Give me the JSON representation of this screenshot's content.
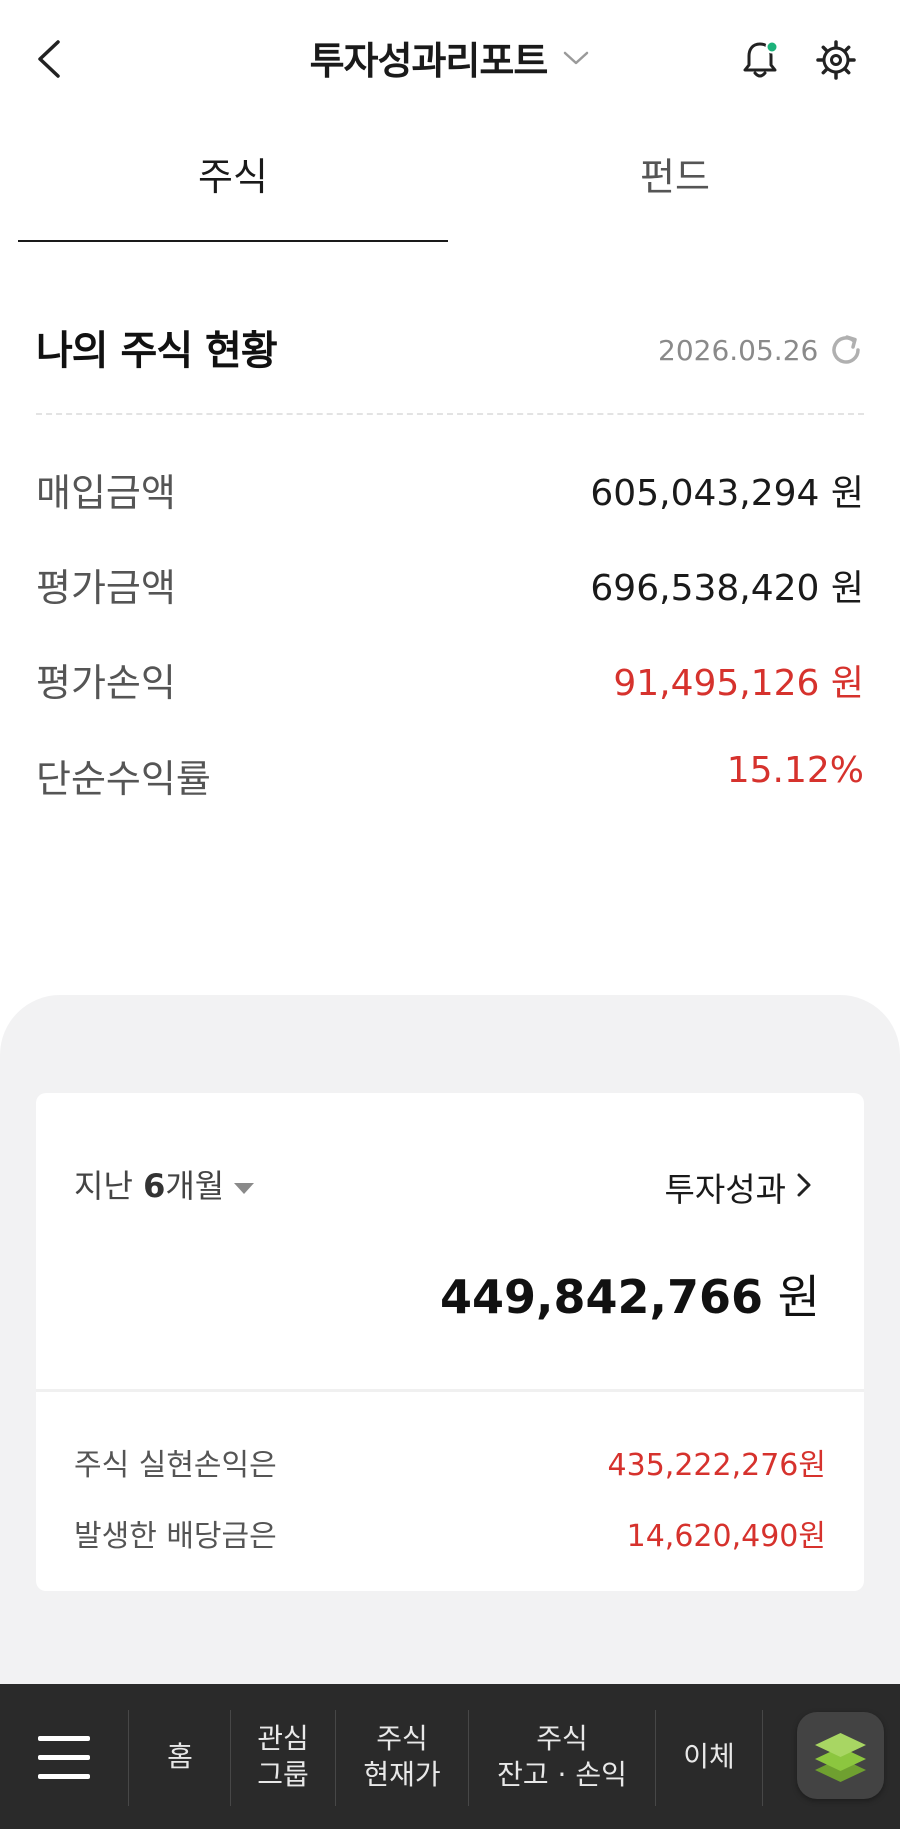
{
  "header": {
    "title": "투자성과리포트",
    "icons": [
      "back-icon",
      "chevron-down-icon",
      "bell-icon",
      "gear-icon"
    ]
  },
  "tabs": [
    {
      "label": "주식",
      "active": true
    },
    {
      "label": "펀드",
      "active": false
    }
  ],
  "summary": {
    "title": "나의 주식 현황",
    "date": "2026.05.26",
    "rows": [
      {
        "label": "매입금액",
        "value": "605,043,294 원"
      },
      {
        "label": "평가금액",
        "value": "696,538,420 원"
      },
      {
        "label": "평가손익",
        "value": "91,495,126 원"
      },
      {
        "label": "단순수익률",
        "value": "15.12%"
      }
    ]
  },
  "performance": {
    "period_prefix": "지난 ",
    "period_number": "6",
    "period_suffix": "개월",
    "link_label": "투자성과",
    "total_value": "449,842,766",
    "total_unit": " 원",
    "realized_label": "주식 실현손익은",
    "realized_value": "435,222,276원",
    "dividend_label": "발생한 배당금은",
    "dividend_value": "14,620,490원"
  },
  "bottom_nav": {
    "items": [
      {
        "line1": "홈",
        "line2": ""
      },
      {
        "line1": "관심",
        "line2": "그룹"
      },
      {
        "line1": "주식",
        "line2": "현재가"
      },
      {
        "line1": "주식",
        "line2": "잔고 · 손익"
      },
      {
        "line1": "이체",
        "line2": ""
      }
    ]
  },
  "colors": {
    "profit_red": "#d6322d",
    "notification_dot": "#1bb27a",
    "layers_green": "#8cc63f",
    "nav_bg": "#2a2a2a",
    "panel_bg": "#f2f2f3"
  }
}
